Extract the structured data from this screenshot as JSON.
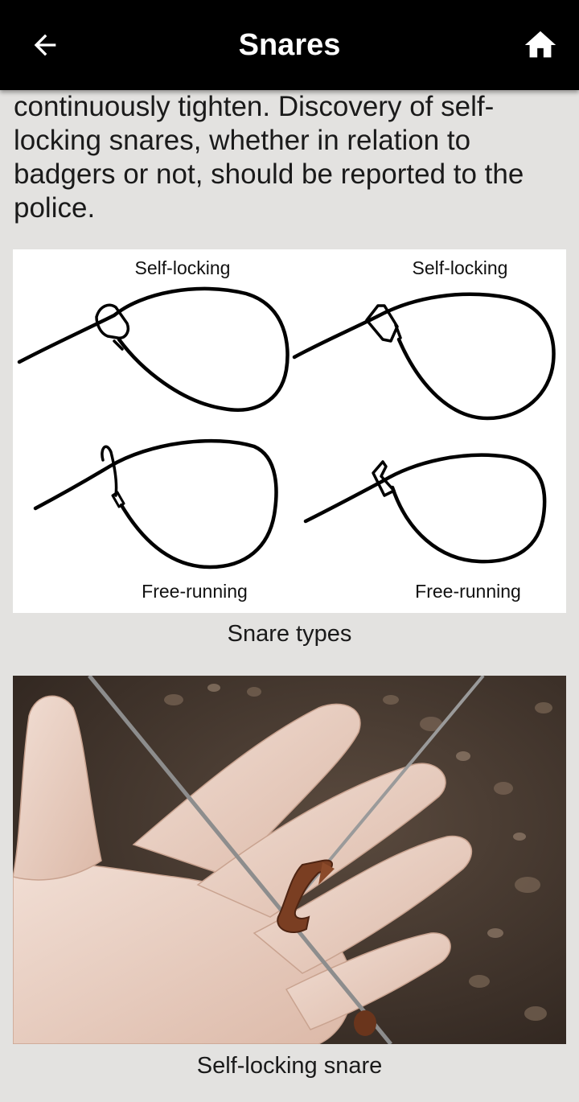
{
  "app_bar": {
    "title": "Snares",
    "back_icon": "arrow-left-icon",
    "home_icon": "home-icon"
  },
  "article": {
    "paragraph": "continuously tighten. Discovery of self-locking snares, whether in relation to badgers or not, should be reported to the police."
  },
  "figures": [
    {
      "caption": "Snare types",
      "labels": {
        "top_left": "Self-locking",
        "top_right": "Self-locking",
        "bottom_left": "Free-running",
        "bottom_right": "Free-running"
      }
    },
    {
      "caption": "Self-locking snare"
    }
  ],
  "colors": {
    "app_bar": "#000000",
    "background": "#e3e2e0",
    "text": "#1a1a1a"
  }
}
